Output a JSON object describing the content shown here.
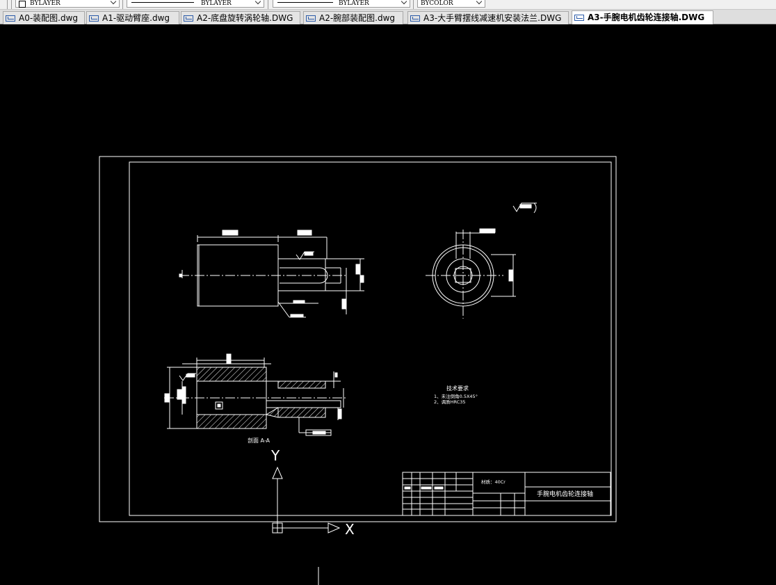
{
  "toolbar": {
    "color_combo": "BYLAYER",
    "linetype_combo": "BYLAYER",
    "lineweight_combo": "BYLAYER",
    "plotstyle_combo": "BYCOLOR"
  },
  "tabs": [
    {
      "label": "A0-装配图.dwg"
    },
    {
      "label": "A1-驱动臂座.dwg"
    },
    {
      "label": "A2-底盘旋转涡轮轴.DWG"
    },
    {
      "label": "A2-腕部装配图.dwg"
    },
    {
      "label": "A3-大手臂摆线减速机安装法兰.DWG"
    },
    {
      "label": "A3-手腕电机齿轮连接轴.DWG"
    }
  ],
  "active_tab": 5,
  "drawing": {
    "section_label": "剖面 A-A",
    "tech_title": "技术要求",
    "tech_items": [
      "1、未注倒角0.5X45°",
      "2、调质HRC35"
    ],
    "material": "材质：40Cr",
    "part_name": "手腕电机齿轮连接轴",
    "ucs_x": "X",
    "ucs_y": "Y"
  },
  "colors": {
    "background": "#000000",
    "line": "#ffffff",
    "toolbar": "#f0f0f0"
  }
}
